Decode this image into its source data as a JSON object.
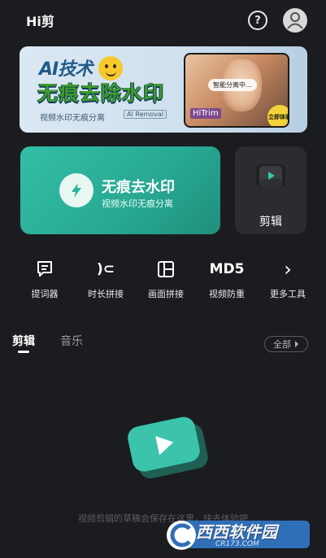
{
  "header": {
    "app_title": "Hi剪",
    "help_icon_text": "?"
  },
  "banner": {
    "ai_text": "AI技术",
    "headline": "无痕去除水印",
    "subtitle": "视频水印无痕分离",
    "tag": "AI Removal",
    "phone_status": "智能分离中...",
    "phone_brand": "HiTrim",
    "phone_badge": "立即体验"
  },
  "cards": {
    "remove": {
      "title": "无痕去水印",
      "subtitle": "视频水印无痕分离"
    },
    "edit": {
      "label": "剪辑"
    }
  },
  "tools": [
    {
      "label": "提词器",
      "icon": "teleprompter-icon"
    },
    {
      "label": "时长拼接",
      "icon": "duration-splice-icon",
      "glyph": ")⊂"
    },
    {
      "label": "画面拼接",
      "icon": "layout-splice-icon"
    },
    {
      "label": "视频防重",
      "icon": "md5-icon",
      "glyph": "MD5"
    },
    {
      "label": "更多工具",
      "icon": "chevron-right-icon",
      "glyph": "›"
    }
  ],
  "tabs": {
    "active": "剪辑",
    "inactive": "音乐",
    "all_label": "全部"
  },
  "empty_state": {
    "text": "视频剪辑的草稿会保存在这里，快去体验吧"
  },
  "watermark": {
    "text": "西西软件园",
    "sub": "CR173.COM"
  },
  "colors": {
    "background": "#1b1c1f",
    "accent": "#2bb39d",
    "card_dark": "#2b2c30"
  }
}
